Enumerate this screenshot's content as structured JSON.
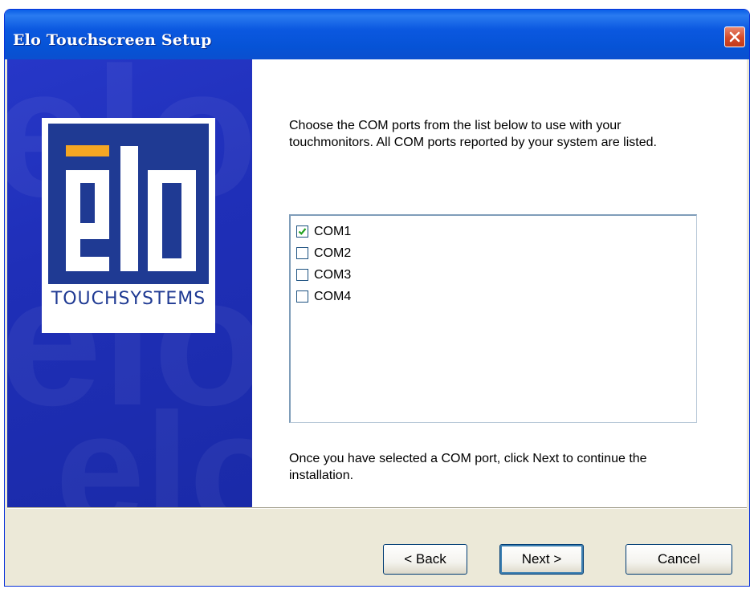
{
  "window": {
    "title": "Elo Touchscreen Setup"
  },
  "logo": {
    "wordmark": "elo",
    "subtitle": "TOUCHSYSTEMS"
  },
  "main": {
    "intro": "Choose the COM ports from the list below to use with your touchmonitors. All COM ports reported by your system are listed.",
    "ports": [
      {
        "label": "COM1",
        "checked": true
      },
      {
        "label": "COM2",
        "checked": false
      },
      {
        "label": "COM3",
        "checked": false
      },
      {
        "label": "COM4",
        "checked": false
      }
    ],
    "outro": "Once you have selected a COM port, click Next to continue the installation."
  },
  "buttons": {
    "back": "< Back",
    "next": "Next >",
    "cancel": "Cancel"
  },
  "colors": {
    "title_bar": "#0653d6",
    "banner": "#1f2fb8",
    "logo_blue": "#1f3a93",
    "logo_accent": "#f5a623",
    "close_button": "#d44a28"
  },
  "icons": {
    "close": "close-icon",
    "check": "checkmark-icon"
  }
}
